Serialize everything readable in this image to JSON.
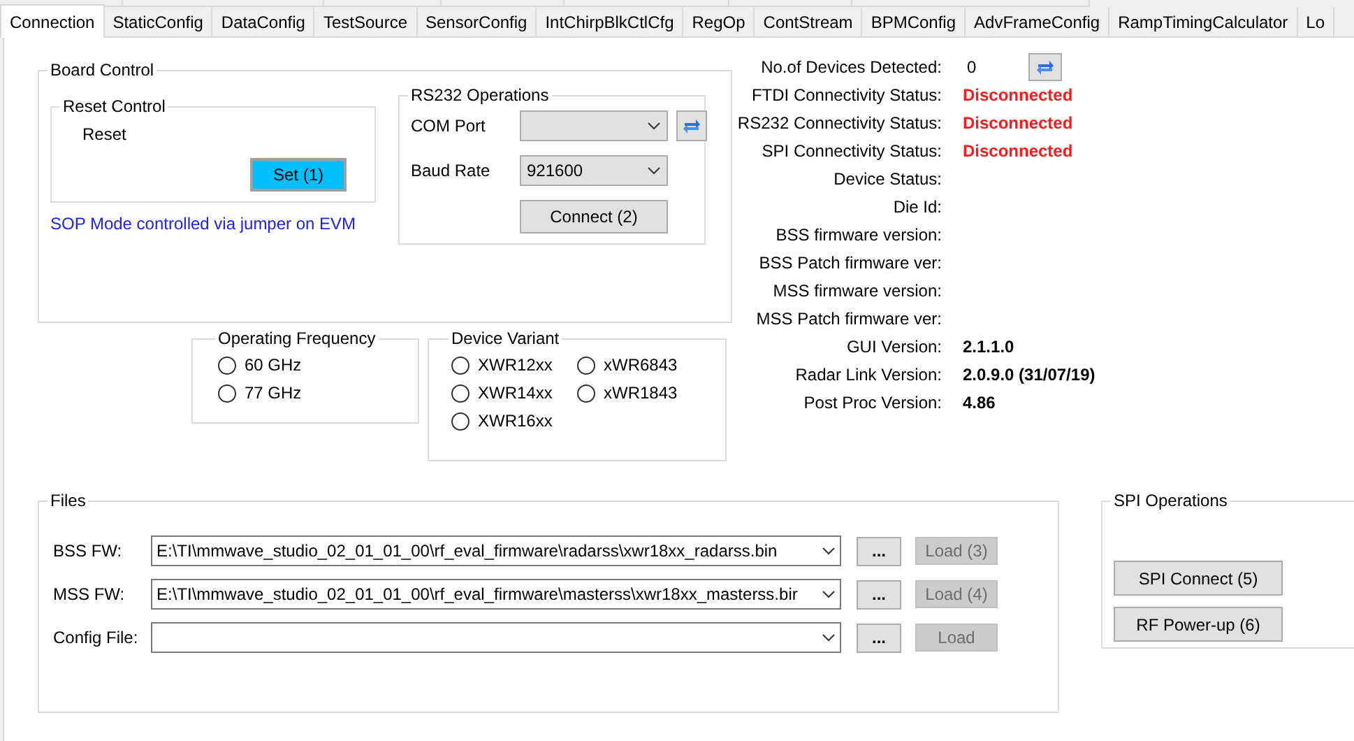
{
  "tabs": [
    {
      "label": "Connection",
      "selected": true
    },
    {
      "label": "StaticConfig",
      "selected": false
    },
    {
      "label": "DataConfig",
      "selected": false
    },
    {
      "label": "TestSource",
      "selected": false
    },
    {
      "label": "SensorConfig",
      "selected": false
    },
    {
      "label": "IntChirpBlkCtlCfg",
      "selected": false
    },
    {
      "label": "RegOp",
      "selected": false
    },
    {
      "label": "ContStream",
      "selected": false
    },
    {
      "label": "BPMConfig",
      "selected": false
    },
    {
      "label": "AdvFrameConfig",
      "selected": false
    },
    {
      "label": "RampTimingCalculator",
      "selected": false
    },
    {
      "label": "Lo",
      "selected": false
    }
  ],
  "board_control": {
    "title": "Board Control",
    "reset_control": {
      "title": "Reset Control",
      "label": "Reset",
      "button": {
        "label": "Set (1)",
        "highlighted": true
      }
    },
    "note": "SOP Mode controlled via jumper on EVM",
    "rs232": {
      "title": "RS232 Operations",
      "com_port": {
        "label": "COM Port"
      },
      "baud_rate": {
        "label": "Baud Rate",
        "value": "921600"
      },
      "connect_button": "Connect (2)"
    }
  },
  "operating_frequency": {
    "title": "Operating Frequency",
    "options": [
      {
        "label": "60 GHz",
        "selected": false
      },
      {
        "label": "77 GHz",
        "selected": false
      }
    ]
  },
  "device_variant": {
    "title": "Device Variant",
    "options": [
      {
        "label": "XWR12xx",
        "selected": false
      },
      {
        "label": "xWR6843",
        "selected": false
      },
      {
        "label": "XWR14xx",
        "selected": false
      },
      {
        "label": "xWR1843",
        "selected": false
      },
      {
        "label": "XWR16xx",
        "selected": false
      }
    ]
  },
  "status": [
    {
      "label": "No.of Devices Detected:",
      "value": "0",
      "kind": "count"
    },
    {
      "label": "FTDI Connectivity Status:",
      "value": "Disconnected",
      "kind": "error"
    },
    {
      "label": "RS232 Connectivity Status:",
      "value": "Disconnected",
      "kind": "error"
    },
    {
      "label": "SPI Connectivity Status:",
      "value": "Disconnected",
      "kind": "error"
    },
    {
      "label": "Device Status:",
      "kind": "empty"
    },
    {
      "label": "Die Id:",
      "kind": "empty"
    },
    {
      "label": "BSS firmware version:",
      "kind": "empty"
    },
    {
      "label": "BSS Patch firmware ver:",
      "kind": "empty"
    },
    {
      "label": "MSS firmware version:",
      "kind": "empty"
    },
    {
      "label": "MSS Patch firmware ver:",
      "kind": "empty"
    },
    {
      "label": "GUI Version:",
      "value": "2.1.1.0",
      "kind": "bold"
    },
    {
      "label": "Radar Link Version:",
      "value": "2.0.9.0 (31/07/19)",
      "kind": "bold"
    },
    {
      "label": "Post Proc Version:",
      "value": "4.86",
      "kind": "bold"
    }
  ],
  "files": {
    "title": "Files",
    "rows": [
      {
        "label": "BSS FW:",
        "value": "E:\\TI\\mmwave_studio_02_01_01_00\\rf_eval_firmware\\radarss\\xwr18xx_radarss.bin",
        "browse": "...",
        "load": "Load (3)",
        "load_disabled": true
      },
      {
        "label": "MSS FW:",
        "value": "E:\\TI\\mmwave_studio_02_01_01_00\\rf_eval_firmware\\masterss\\xwr18xx_masterss.bir",
        "browse": "...",
        "load": "Load (4)",
        "load_disabled": true
      },
      {
        "label": "Config File:",
        "browse": "...",
        "load": "Load",
        "load_disabled": true
      }
    ]
  },
  "spi": {
    "title": "SPI Operations",
    "buttons": [
      "SPI Connect (5)",
      "RF Power-up (6)"
    ]
  }
}
